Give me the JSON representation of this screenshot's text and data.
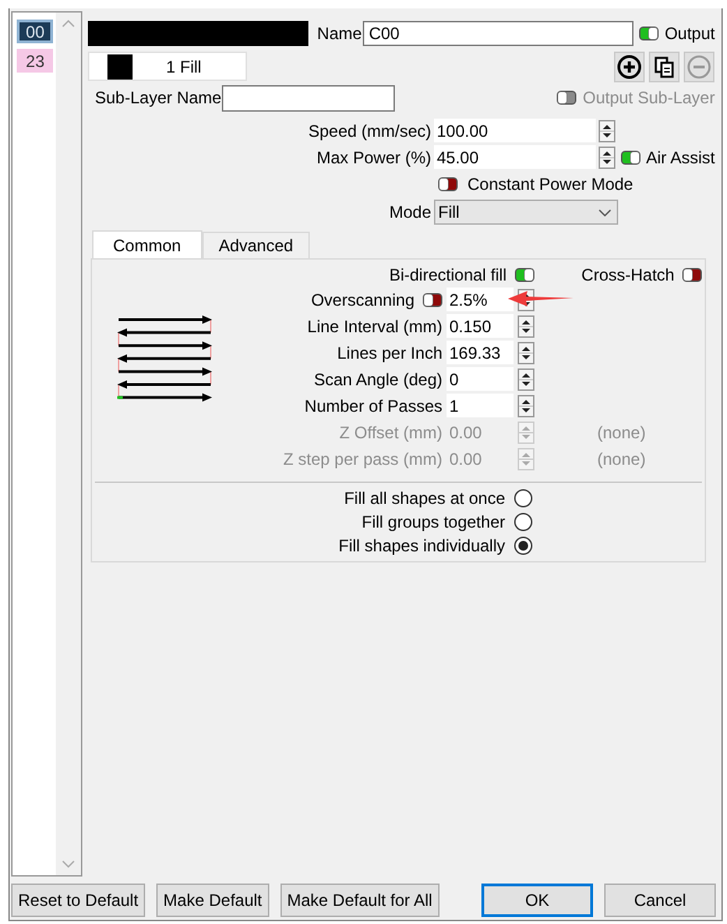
{
  "layers": [
    {
      "label": "00",
      "color": "#1c3b57",
      "selected": true
    },
    {
      "label": "23",
      "color": "#f5c8e6",
      "selected": false
    }
  ],
  "layer_swatch": {
    "color": "#000000"
  },
  "name": {
    "label": "Name",
    "value": "C00"
  },
  "output": {
    "label": "Output",
    "on": true
  },
  "sublayers": [
    {
      "label": "1 Fill",
      "color": "#000000",
      "selected": true
    }
  ],
  "sublayer_actions": [
    {
      "kind": "add",
      "disabled": false
    },
    {
      "kind": "copy",
      "disabled": false
    },
    {
      "kind": "remove",
      "disabled": true
    }
  ],
  "sublayer_name": {
    "label": "Sub-Layer Name"
  },
  "output_sublayer": {
    "label": "Output Sub-Layer",
    "on": false,
    "disabled": true
  },
  "settings": [
    {
      "label": "Speed (mm/sec)",
      "value": "100.00"
    },
    {
      "label": "Max Power (%)",
      "value": "45.00",
      "toggle": {
        "label": "Air Assist",
        "on": true
      }
    }
  ],
  "constant_power": {
    "label": "Constant Power Mode",
    "on": false
  },
  "mode": {
    "label": "Mode",
    "value": "Fill"
  },
  "tabs": [
    {
      "label": "Common",
      "selected": true
    },
    {
      "label": "Advanced",
      "selected": false
    }
  ],
  "bidirectional": {
    "label": "Bi-directional fill",
    "on": true
  },
  "cross_hatch": {
    "label": "Cross-Hatch",
    "on": false
  },
  "fill_settings": [
    {
      "label": "Overscanning",
      "value": "2.5%",
      "disabled": false,
      "toggle": {
        "on": false
      }
    },
    {
      "label": "Line Interval (mm)",
      "value": "0.150",
      "disabled": false
    },
    {
      "label": "Lines per Inch",
      "value": "169.33",
      "disabled": false
    },
    {
      "label": "Scan Angle (deg)",
      "value": "0",
      "disabled": false
    },
    {
      "label": "Number of Passes",
      "value": "1",
      "disabled": false
    },
    {
      "label": "Z Offset (mm)",
      "value": "0.00",
      "disabled": true,
      "note": "(none)"
    },
    {
      "label": "Z step per pass (mm)",
      "value": "0.00",
      "disabled": true,
      "note": "(none)"
    }
  ],
  "fill_order": [
    {
      "label": "Fill all shapes at once",
      "selected": false
    },
    {
      "label": "Fill groups together",
      "selected": false
    },
    {
      "label": "Fill shapes individually",
      "selected": true
    }
  ],
  "buttons": [
    {
      "label": "Reset to Default",
      "default": false
    },
    {
      "label": "Make Default",
      "default": false
    },
    {
      "label": "Make Default for All",
      "default": false
    },
    {
      "label": "OK",
      "default": true
    },
    {
      "label": "Cancel",
      "default": false
    }
  ]
}
